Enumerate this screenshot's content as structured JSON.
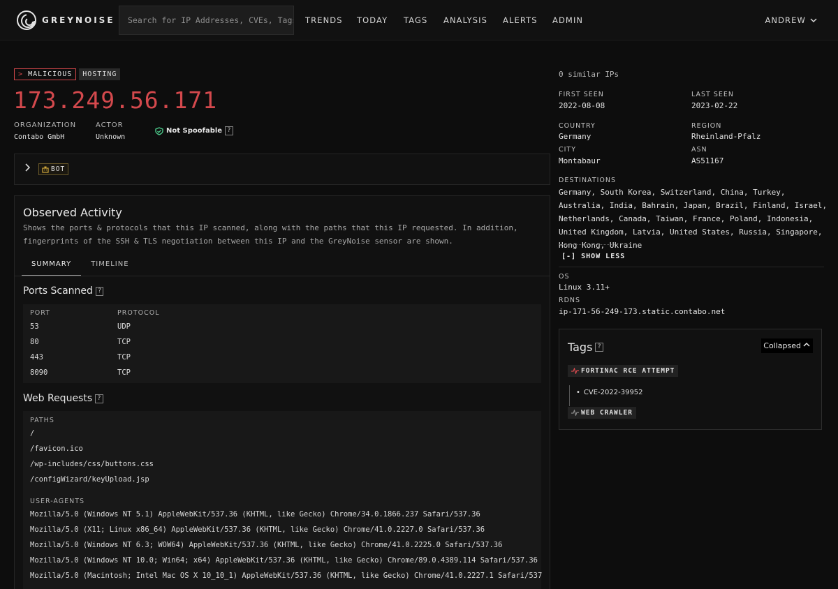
{
  "nav": {
    "brand": "GREYNOISE",
    "search_placeholder": "Search for IP Addresses, CVEs, Tags...",
    "items": [
      "TRENDS",
      "TODAY",
      "TAGS",
      "ANALYSIS",
      "ALERTS",
      "ADMIN"
    ],
    "user": "ANDREW"
  },
  "header": {
    "badge_malicious": "MALICIOUS",
    "badge_malicious_prefix": ">",
    "badge_hosting": "HOSTING",
    "ip": "173.249.56.171",
    "org_label": "ORGANIZATION",
    "org_value": "Contabo GmbH",
    "actor_label": "ACTOR",
    "actor_value": "Unknown",
    "spoof_text": "Not Spoofable",
    "help": "?"
  },
  "bot_badge": "BOT",
  "observed": {
    "title": "Observed Activity",
    "description": "Shows the ports & protocols that this IP scanned, along with the paths that this IP requested. In addition, fingerprints of the SSH & TLS negotiation between this IP and the GreyNoise sensor are shown.",
    "tabs": [
      "SUMMARY",
      "TIMELINE"
    ],
    "ports_title": "Ports Scanned",
    "ports_headers": [
      "PORT",
      "PROTOCOL"
    ],
    "ports": [
      {
        "port": "53",
        "protocol": "UDP"
      },
      {
        "port": "80",
        "protocol": "TCP"
      },
      {
        "port": "443",
        "protocol": "TCP"
      },
      {
        "port": "8090",
        "protocol": "TCP"
      }
    ],
    "web_title": "Web Requests",
    "paths_label": "PATHS",
    "paths": [
      "/",
      "/favicon.ico",
      "/wp-includes/css/buttons.css",
      "/configWizard/keyUpload.jsp"
    ],
    "ua_label": "USER-AGENTS",
    "user_agents": [
      "Mozilla/5.0 (Windows NT 5.1) AppleWebKit/537.36 (KHTML, like Gecko) Chrome/34.0.1866.237 Safari/537.36",
      "Mozilla/5.0 (X11; Linux x86_64) AppleWebKit/537.36 (KHTML, like Gecko) Chrome/41.0.2227.0 Safari/537.36",
      "Mozilla/5.0 (Windows NT 6.3; WOW64) AppleWebKit/537.36 (KHTML, like Gecko) Chrome/41.0.2225.0 Safari/537.36",
      "Mozilla/5.0 (Windows NT 10.0; Win64; x64) AppleWebKit/537.36 (KHTML, like Gecko) Chrome/89.0.4389.114 Safari/537.36",
      "Mozilla/5.0 (Macintosh; Intel Mac OS X 10_10_1) AppleWebKit/537.36 (KHTML, like Gecko) Chrome/41.0.2227.1 Safari/537"
    ]
  },
  "details": {
    "similar": "0 similar IPs",
    "first_seen_label": "FIRST SEEN",
    "first_seen": "2022-08-08",
    "last_seen_label": "LAST SEEN",
    "last_seen": "2023-02-22",
    "country_label": "COUNTRY",
    "country": "Germany",
    "region_label": "REGION",
    "region": "Rheinland-Pfalz",
    "city_label": "CITY",
    "city": "Montabaur",
    "asn_label": "ASN",
    "asn": "AS51167",
    "destinations_label": "DESTINATIONS",
    "destinations": "Germany, South Korea, Switzerland, China, Turkey, Australia, India, Bahrain, Japan, Brazil, Finland, Israel, Netherlands, Canada, Taiwan, France, Poland, Indonesia, United Kingdom, Latvia, United States, Russia, Singapore, Hong Kong, Ukraine",
    "show_less": "[-] SHOW LESS",
    "os_label": "OS",
    "os": "Linux 3.11+",
    "rdns_label": "RDNS",
    "rdns": "ip-171-56-249-173.static.contabo.net"
  },
  "tags": {
    "title": "Tags",
    "collapsed": "Collapsed",
    "tag1": "FORTINAC RCE ATTEMPT",
    "cve": "CVE-2022-39952",
    "tag2": "WEB CRAWLER"
  },
  "colors": {
    "malicious": "#d4494d",
    "bot": "#d2a93c",
    "not_spoofable": "#4cc98a"
  }
}
